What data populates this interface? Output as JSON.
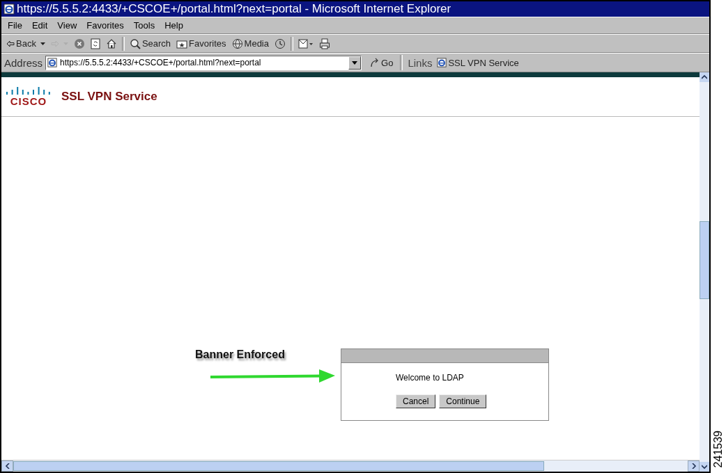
{
  "window": {
    "title": "https://5.5.5.2:4433/+CSCOE+/portal.html?next=portal - Microsoft Internet Explorer"
  },
  "menu": [
    "File",
    "Edit",
    "View",
    "Favorites",
    "Tools",
    "Help"
  ],
  "toolbar": [
    {
      "kind": "back",
      "label": "Back",
      "disabled": false
    },
    {
      "kind": "forward",
      "disabled": true
    },
    {
      "kind": "stop",
      "disabled": false
    },
    {
      "kind": "refresh",
      "disabled": false
    },
    {
      "kind": "home",
      "disabled": false
    },
    {
      "kind": "search",
      "label": "Search",
      "disabled": false
    },
    {
      "kind": "favorites",
      "label": "Favorites",
      "disabled": false
    },
    {
      "kind": "media",
      "label": "Media",
      "disabled": false
    },
    {
      "kind": "history",
      "disabled": false
    },
    {
      "kind": "mail",
      "disabled": false
    },
    {
      "kind": "print",
      "disabled": false
    }
  ],
  "address": {
    "label": "Address",
    "value": "https://5.5.5.2:4433/+CSCOE+/portal.html?next=portal",
    "go": "Go"
  },
  "links": {
    "label": "Links",
    "items": [
      "SSL VPN Service"
    ]
  },
  "header": {
    "logo": "CISCO",
    "title": "SSL VPN Service"
  },
  "annotation": {
    "label": "Banner Enforced"
  },
  "dialog": {
    "message": "Welcome to LDAP",
    "buttons": [
      "Cancel",
      "Continue"
    ]
  },
  "figure_id": "241539"
}
